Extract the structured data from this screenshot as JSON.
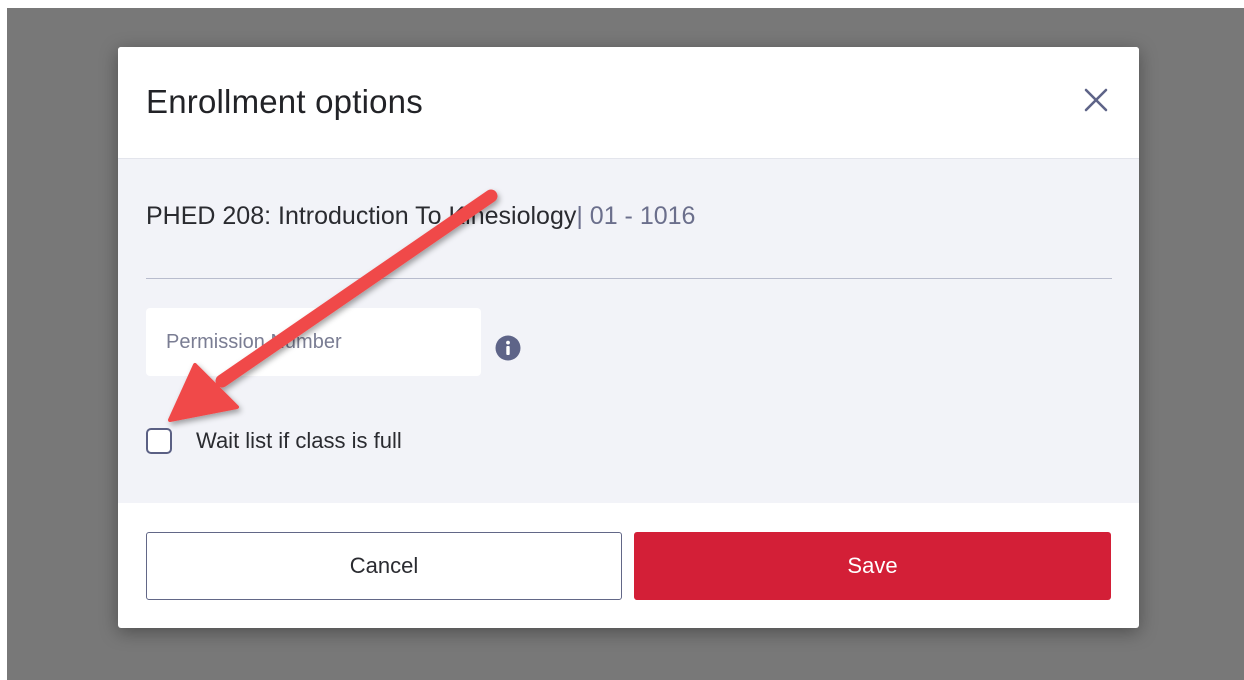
{
  "modal": {
    "title": "Enrollment options",
    "close_icon": "close-icon"
  },
  "course": {
    "name": "PHED 208: Introduction To Kinesiology",
    "separator": "|",
    "section": " 01 - 1016"
  },
  "permission": {
    "placeholder": "Permission Number",
    "value": "",
    "info_icon": "info-icon"
  },
  "waitlist": {
    "label": "Wait list if class is full",
    "checked": false
  },
  "buttons": {
    "cancel_label": "Cancel",
    "save_label": "Save"
  },
  "colors": {
    "backdrop": "#787878",
    "body_bg": "#f2f3f8",
    "accent": "#d31f37",
    "muted_text": "#6b6f8c",
    "annotation_arrow": "#f04a4a"
  }
}
